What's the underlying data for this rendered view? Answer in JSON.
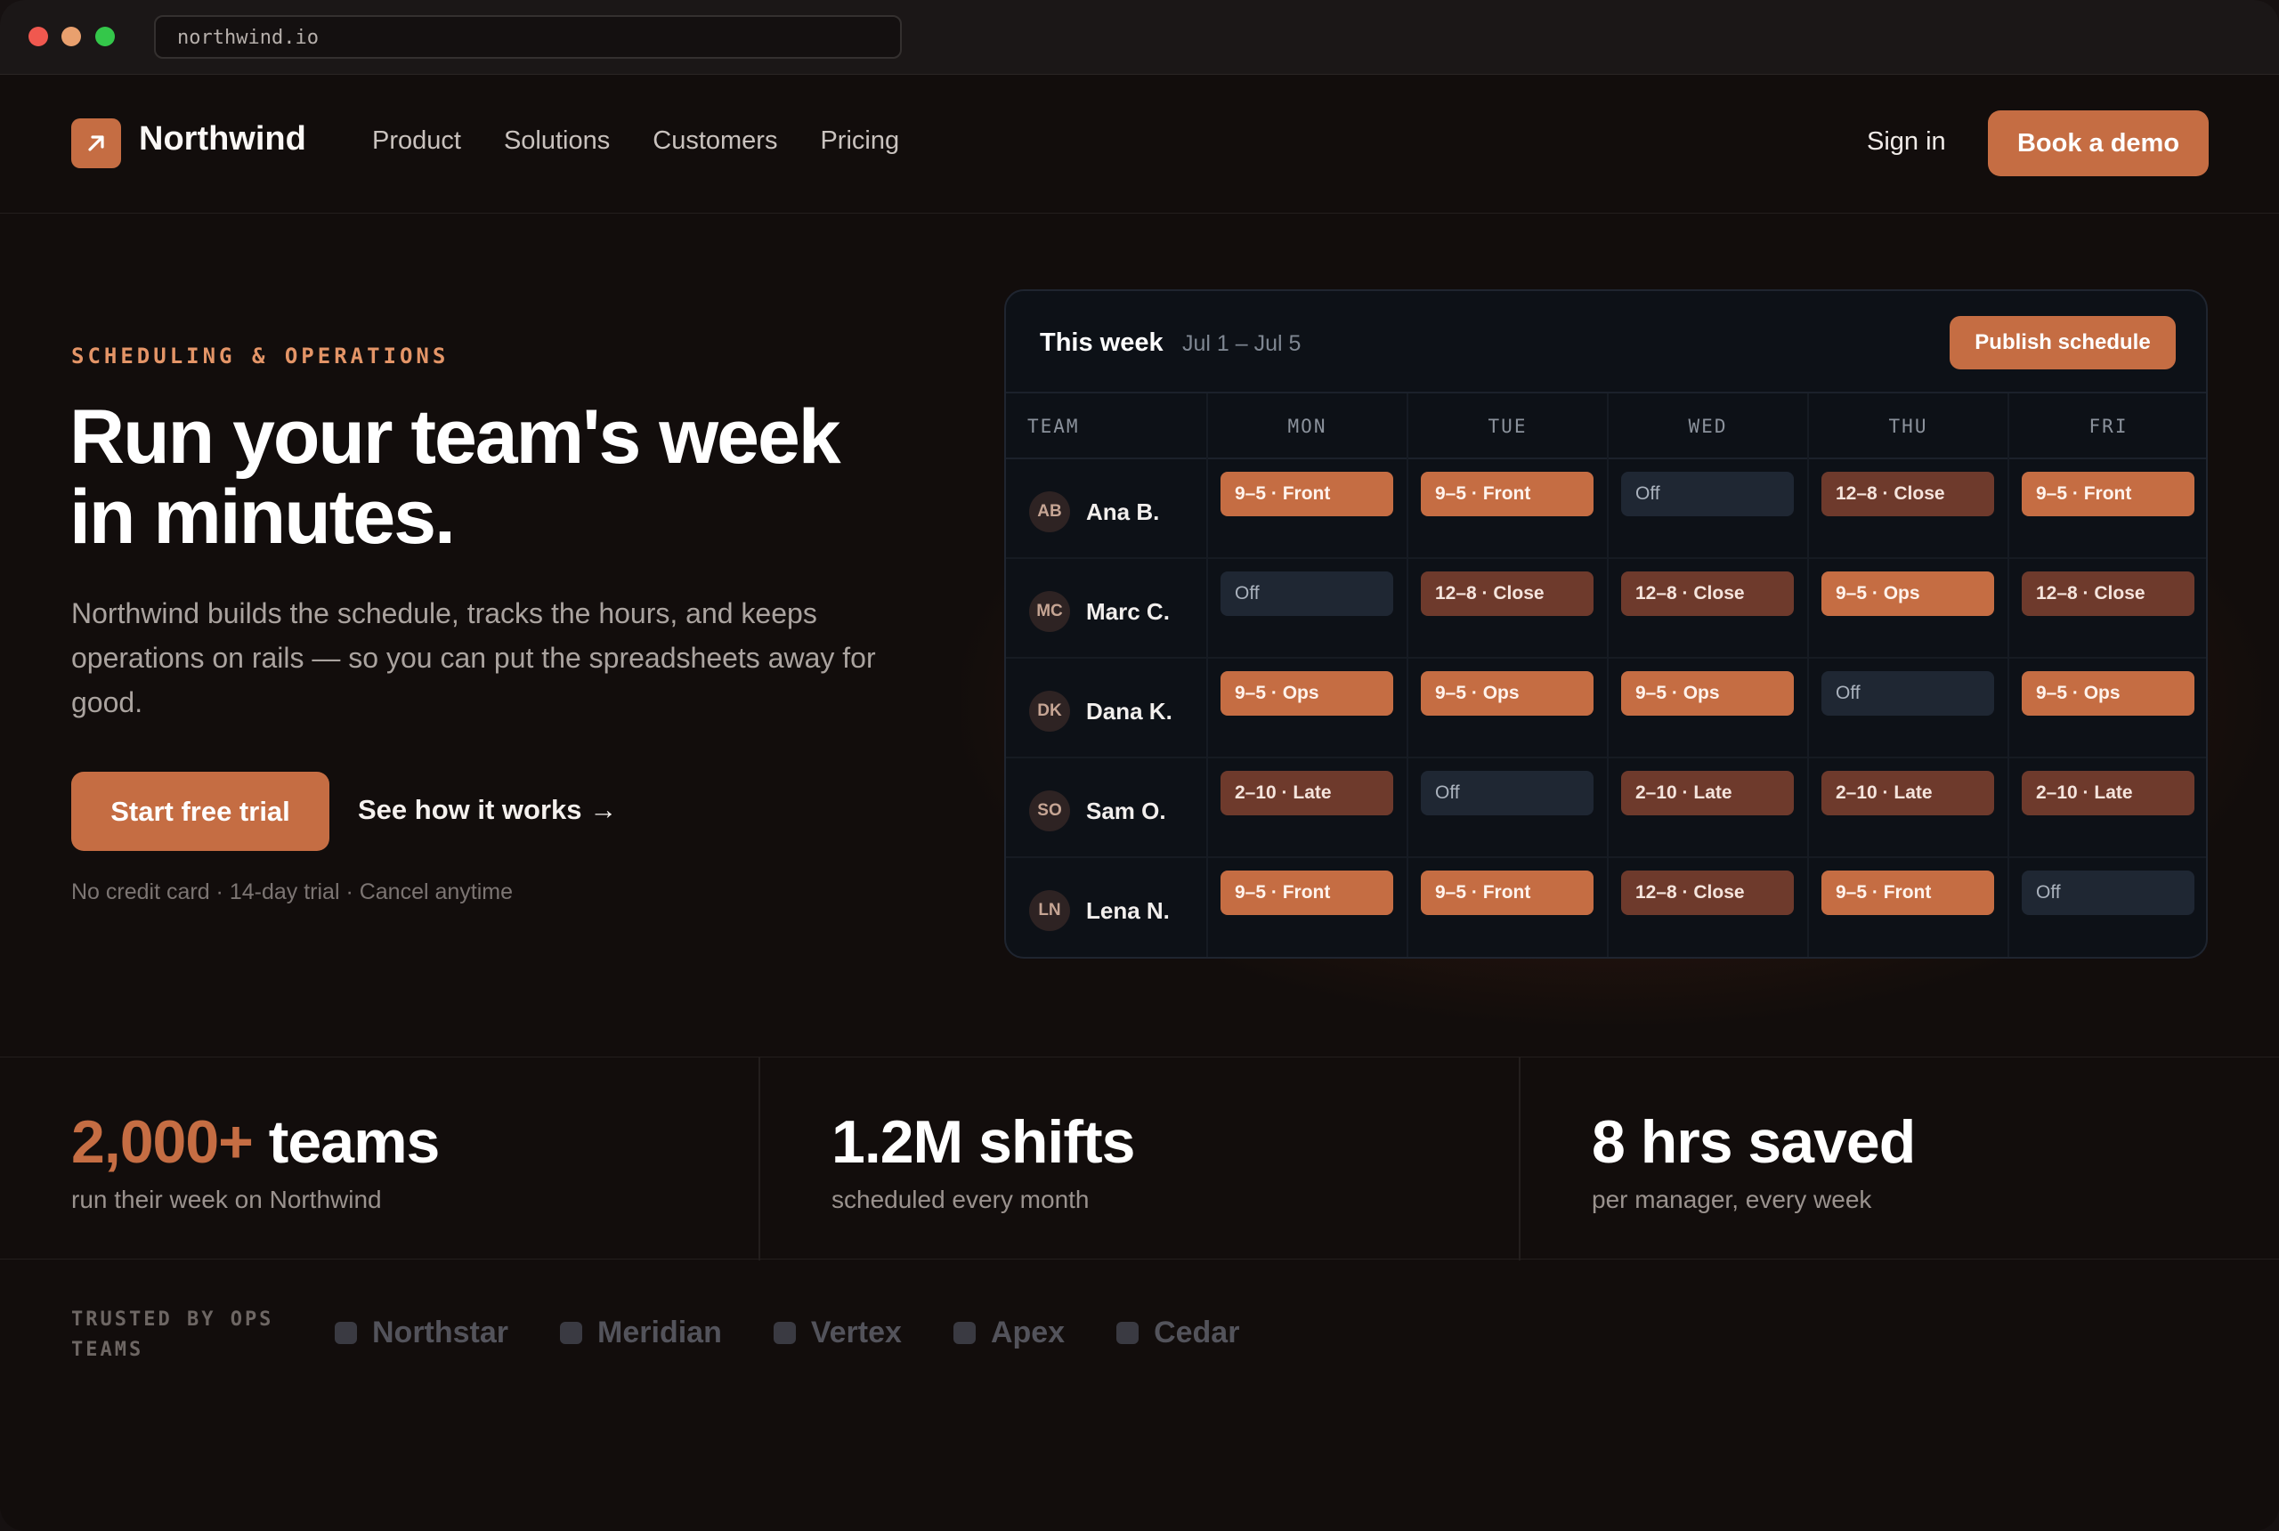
{
  "browser": {
    "url": "northwind.io"
  },
  "nav": {
    "brand": "Northwind",
    "links": [
      "Product",
      "Solutions",
      "Customers",
      "Pricing"
    ],
    "sign_in": "Sign in",
    "cta": "Book a demo"
  },
  "hero": {
    "eyebrow": "SCHEDULING & OPERATIONS",
    "headline_line1": "Run your team's week",
    "headline_line2": "in minutes.",
    "sub": "Northwind builds the schedule, tracks the hours, and keeps operations on rails — so you can put the spreadsheets away for good.",
    "primary_cta": "Start free trial",
    "secondary_cta": "See how it works →",
    "fineprint": "No credit card · 14-day trial · Cancel anytime"
  },
  "schedule": {
    "title": "This week",
    "range": "Jul 1 – Jul 5",
    "publish": "Publish schedule",
    "columns": [
      "TEAM",
      "MON",
      "TUE",
      "WED",
      "THU",
      "FRI"
    ],
    "rows": [
      {
        "initials": "AB",
        "name": "Ana B.",
        "shifts": [
          {
            "label": "9–5 · Front",
            "kind": "orange"
          },
          {
            "label": "9–5 · Front",
            "kind": "orange"
          },
          {
            "label": "Off",
            "kind": "off"
          },
          {
            "label": "12–8 · Close",
            "kind": "brown"
          },
          {
            "label": "9–5 · Front",
            "kind": "orange"
          }
        ]
      },
      {
        "initials": "MC",
        "name": "Marc C.",
        "shifts": [
          {
            "label": "Off",
            "kind": "off"
          },
          {
            "label": "12–8 · Close",
            "kind": "brown"
          },
          {
            "label": "12–8 · Close",
            "kind": "brown"
          },
          {
            "label": "9–5 · Ops",
            "kind": "orange"
          },
          {
            "label": "12–8 · Close",
            "kind": "brown"
          }
        ]
      },
      {
        "initials": "DK",
        "name": "Dana K.",
        "shifts": [
          {
            "label": "9–5 · Ops",
            "kind": "orange"
          },
          {
            "label": "9–5 · Ops",
            "kind": "orange"
          },
          {
            "label": "9–5 · Ops",
            "kind": "orange"
          },
          {
            "label": "Off",
            "kind": "off"
          },
          {
            "label": "9–5 · Ops",
            "kind": "orange"
          }
        ]
      },
      {
        "initials": "SO",
        "name": "Sam O.",
        "shifts": [
          {
            "label": "2–10 · Late",
            "kind": "brown"
          },
          {
            "label": "Off",
            "kind": "off"
          },
          {
            "label": "2–10 · Late",
            "kind": "brown"
          },
          {
            "label": "2–10 · Late",
            "kind": "brown"
          },
          {
            "label": "2–10 · Late",
            "kind": "brown"
          }
        ]
      },
      {
        "initials": "LN",
        "name": "Lena N.",
        "shifts": [
          {
            "label": "9–5 · Front",
            "kind": "orange"
          },
          {
            "label": "9–5 · Front",
            "kind": "orange"
          },
          {
            "label": "12–8 · Close",
            "kind": "brown"
          },
          {
            "label": "9–5 · Front",
            "kind": "orange"
          },
          {
            "label": "Off",
            "kind": "off"
          }
        ]
      }
    ]
  },
  "stats": [
    {
      "accent": "2,000+",
      "rest": " teams",
      "caption": "run their week on Northwind"
    },
    {
      "accent": "",
      "rest": "1.2M shifts",
      "caption": "scheduled every month"
    },
    {
      "accent": "",
      "rest": "8 hrs saved",
      "caption": "per manager, every week"
    }
  ],
  "trusted": {
    "label": "TRUSTED BY OPS TEAMS",
    "brands": [
      "Northstar",
      "Meridian",
      "Vertex",
      "Apex",
      "Cedar"
    ]
  },
  "colors": {
    "accent": "#c56d43",
    "accent_dark": "#6e3a2c",
    "background": "#120d0c",
    "card": "#0d1117"
  }
}
